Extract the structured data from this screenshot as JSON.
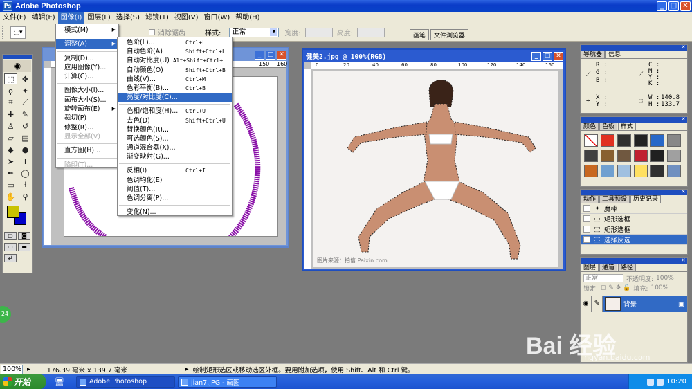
{
  "app": {
    "title": "Adobe Photoshop"
  },
  "menubar": {
    "items": [
      "文件(F)",
      "编辑(E)",
      "图像(I)",
      "图层(L)",
      "选择(S)",
      "滤镜(T)",
      "视图(V)",
      "窗口(W)",
      "帮助(H)"
    ]
  },
  "options": {
    "anti_alias": "消除锯齿",
    "style_label": "样式:",
    "style_value": "正常",
    "width_label": "宽度:",
    "height_label": "高度:"
  },
  "palette_well": {
    "brushes": "画笔",
    "file_browser": "文件浏览器"
  },
  "image_menu": {
    "items": [
      {
        "label": "模式(M)",
        "submenu": true
      },
      {
        "label": "调整(A)",
        "submenu": true,
        "highlighted": true
      },
      {
        "label": "复制(D)..."
      },
      {
        "label": "应用图像(Y)..."
      },
      {
        "label": "计算(C)..."
      },
      {
        "label": "图像大小(I)..."
      },
      {
        "label": "画布大小(S)..."
      },
      {
        "label": "旋转画布(E)",
        "submenu": true
      },
      {
        "label": "裁切(P)"
      },
      {
        "label": "修整(R)..."
      },
      {
        "label": "显示全部(V)",
        "disabled": true
      },
      {
        "label": "直方图(H)..."
      },
      {
        "label": "陷印(T)...",
        "disabled": true
      }
    ]
  },
  "adjust_menu": {
    "items": [
      {
        "label": "色阶(L)...",
        "shortcut": "Ctrl+L"
      },
      {
        "label": "自动色阶(A)",
        "shortcut": "Shift+Ctrl+L"
      },
      {
        "label": "自动对比度(U)",
        "shortcut": "Alt+Shift+Ctrl+L"
      },
      {
        "label": "自动颜色(O)",
        "shortcut": "Shift+Ctrl+B"
      },
      {
        "label": "曲线(V)...",
        "shortcut": "Ctrl+M"
      },
      {
        "label": "色彩平衡(B)...",
        "shortcut": "Ctrl+B"
      },
      {
        "label": "亮度/对比度(C)...",
        "shortcut": "",
        "highlighted": true
      },
      {
        "label": "色相/饱和度(H)...",
        "shortcut": "Ctrl+U"
      },
      {
        "label": "去色(D)",
        "shortcut": "Shift+Ctrl+U"
      },
      {
        "label": "替换颜色(R)...",
        "shortcut": ""
      },
      {
        "label": "可选颜色(S)...",
        "shortcut": ""
      },
      {
        "label": "通道混合器(X)...",
        "shortcut": ""
      },
      {
        "label": "渐变映射(G)...",
        "shortcut": ""
      },
      {
        "label": "反相(I)",
        "shortcut": "Ctrl+I"
      },
      {
        "label": "色调均化(E)",
        "shortcut": ""
      },
      {
        "label": "阈值(T)...",
        "shortcut": ""
      },
      {
        "label": "色调分离(P)...",
        "shortcut": ""
      },
      {
        "label": "变化(N)...",
        "shortcut": ""
      }
    ]
  },
  "doc1": {
    "ruler_ticks": [
      "150",
      "160"
    ]
  },
  "doc2": {
    "title": "健美2.jpg @ 100%(RGB)",
    "ruler_ticks": [
      "0",
      "20",
      "40",
      "60",
      "80",
      "100",
      "120",
      "140",
      "160"
    ],
    "credit": "图片来源：拍信 Paixin.com"
  },
  "info_panel": {
    "tabs": [
      "导航器",
      "信息"
    ],
    "labels": {
      "R": "R :",
      "G": "G :",
      "B": "B :",
      "C": "C :",
      "M": "M :",
      "Y": "Y :",
      "K": "K :",
      "X": "X :",
      "Yc": "Y :",
      "W": "W :",
      "H": "H :"
    },
    "w_value": "140.8",
    "h_value": "133.7"
  },
  "swatches_panel": {
    "tabs": [
      "颜色",
      "色板",
      "样式"
    ],
    "colors": [
      "#ffffff",
      "#e03020",
      "#303030",
      "#222222",
      "#2868c8",
      "#888888",
      "#404040",
      "#886030",
      "#705840",
      "#c02030",
      "#202020",
      "#a0a0a0",
      "#c86820",
      "#70a0d0",
      "#a0c0e0",
      "#ffe060",
      "#303030",
      "#7090c0"
    ]
  },
  "history_panel": {
    "tabs": [
      "动作",
      "工具预设",
      "历史记录"
    ],
    "rows": [
      {
        "icon": "✦",
        "label": "魔棒"
      },
      {
        "icon": "⬚",
        "label": "矩形选框"
      },
      {
        "icon": "⬚",
        "label": "矩形选框"
      },
      {
        "icon": "⬚",
        "label": "选择反选",
        "highlighted": true
      }
    ]
  },
  "layers_panel": {
    "tabs": [
      "图层",
      "通道",
      "路径"
    ],
    "blend": "正常",
    "opacity_label": "不透明度:",
    "opacity_value": "100%",
    "lock_label": "锁定:",
    "fill_label": "填充:",
    "fill_value": "100%",
    "layer_name": "背景"
  },
  "statusbar": {
    "zoom": "100%",
    "dims": "176.39 毫米 x 139.7 毫米",
    "hint": "绘制矩形选区或移动选区外框。要用附加选项，使用 Shift、Alt 和 Ctrl 键。"
  },
  "taskbar": {
    "start": "开始",
    "tasks": [
      "Adobe Photoshop",
      "jian7.JPG - 画图"
    ],
    "clock": "10:20"
  },
  "badge": {
    "text": "24"
  },
  "watermark": {
    "text": "Bai 经验",
    "sub": "jingyan.baidu.com"
  },
  "colors": {
    "accent": "#316ac5",
    "fg_color": "#c9c200",
    "bg_color": "#0000c8"
  }
}
